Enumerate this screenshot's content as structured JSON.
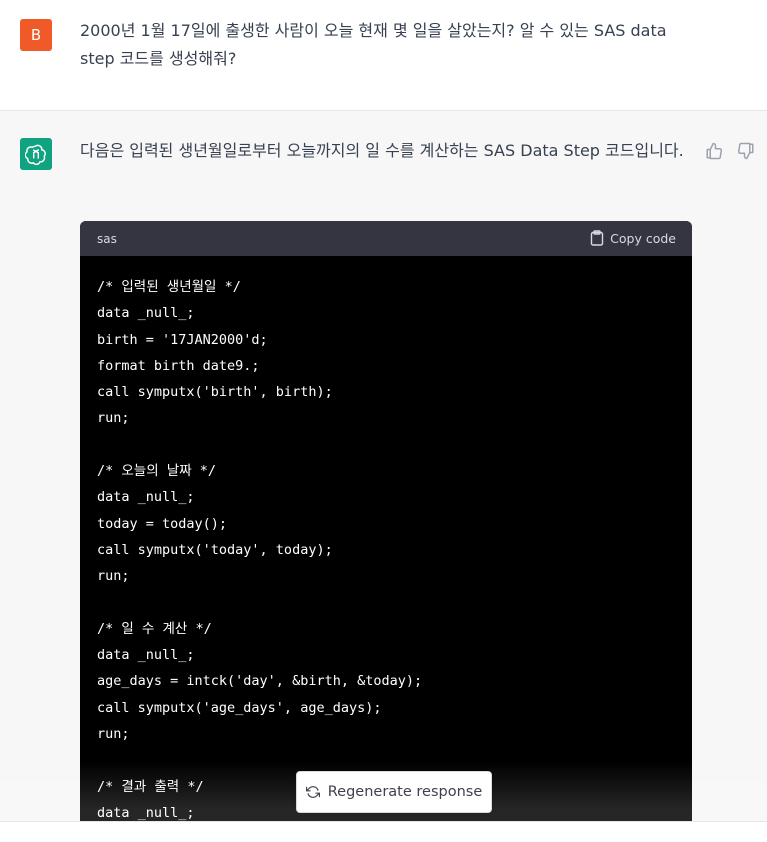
{
  "user": {
    "avatar_letter": "B",
    "message": "2000년 1월 17일에 출생한 사람이 오늘 현재 몇 일을 살았는지? 알 수 있는 SAS data step 코드를 생성해줘?"
  },
  "assistant": {
    "intro": "다음은 입력된 생년월일로부터 오늘까지의 일 수를 계산하는 SAS Data Step 코드입니다.",
    "code_language": "sas",
    "copy_label": "Copy code",
    "code_lines": [
      "/* 입력된 생년월일 */",
      "data _null_;",
      "birth = '17JAN2000'd;",
      "format birth date9.;",
      "call symputx('birth', birth);",
      "run;",
      "",
      "/* 오늘의 날짜 */",
      "data _null_;",
      "today = today();",
      "call symputx('today', today);",
      "run;",
      "",
      "/* 일 수 계산 */",
      "data _null_;",
      "age_days = intck('day', &birth, &today);",
      "call symputx('age_days', age_days);",
      "run;",
      "",
      "/* 결과 출력 */",
      "data _null_;"
    ]
  },
  "regenerate_label": "Regenerate response",
  "icons": {
    "user_avatar": "user-avatar",
    "bot_avatar": "openai-logo-icon",
    "thumbs_up": "thumbs-up-icon",
    "thumbs_down": "thumbs-down-icon",
    "clipboard": "clipboard-icon",
    "refresh": "refresh-icon"
  },
  "colors": {
    "user_avatar_bg": "#f05a28",
    "bot_avatar_bg": "#10a37f",
    "code_bg": "#000000",
    "code_header_bg": "#343541"
  }
}
